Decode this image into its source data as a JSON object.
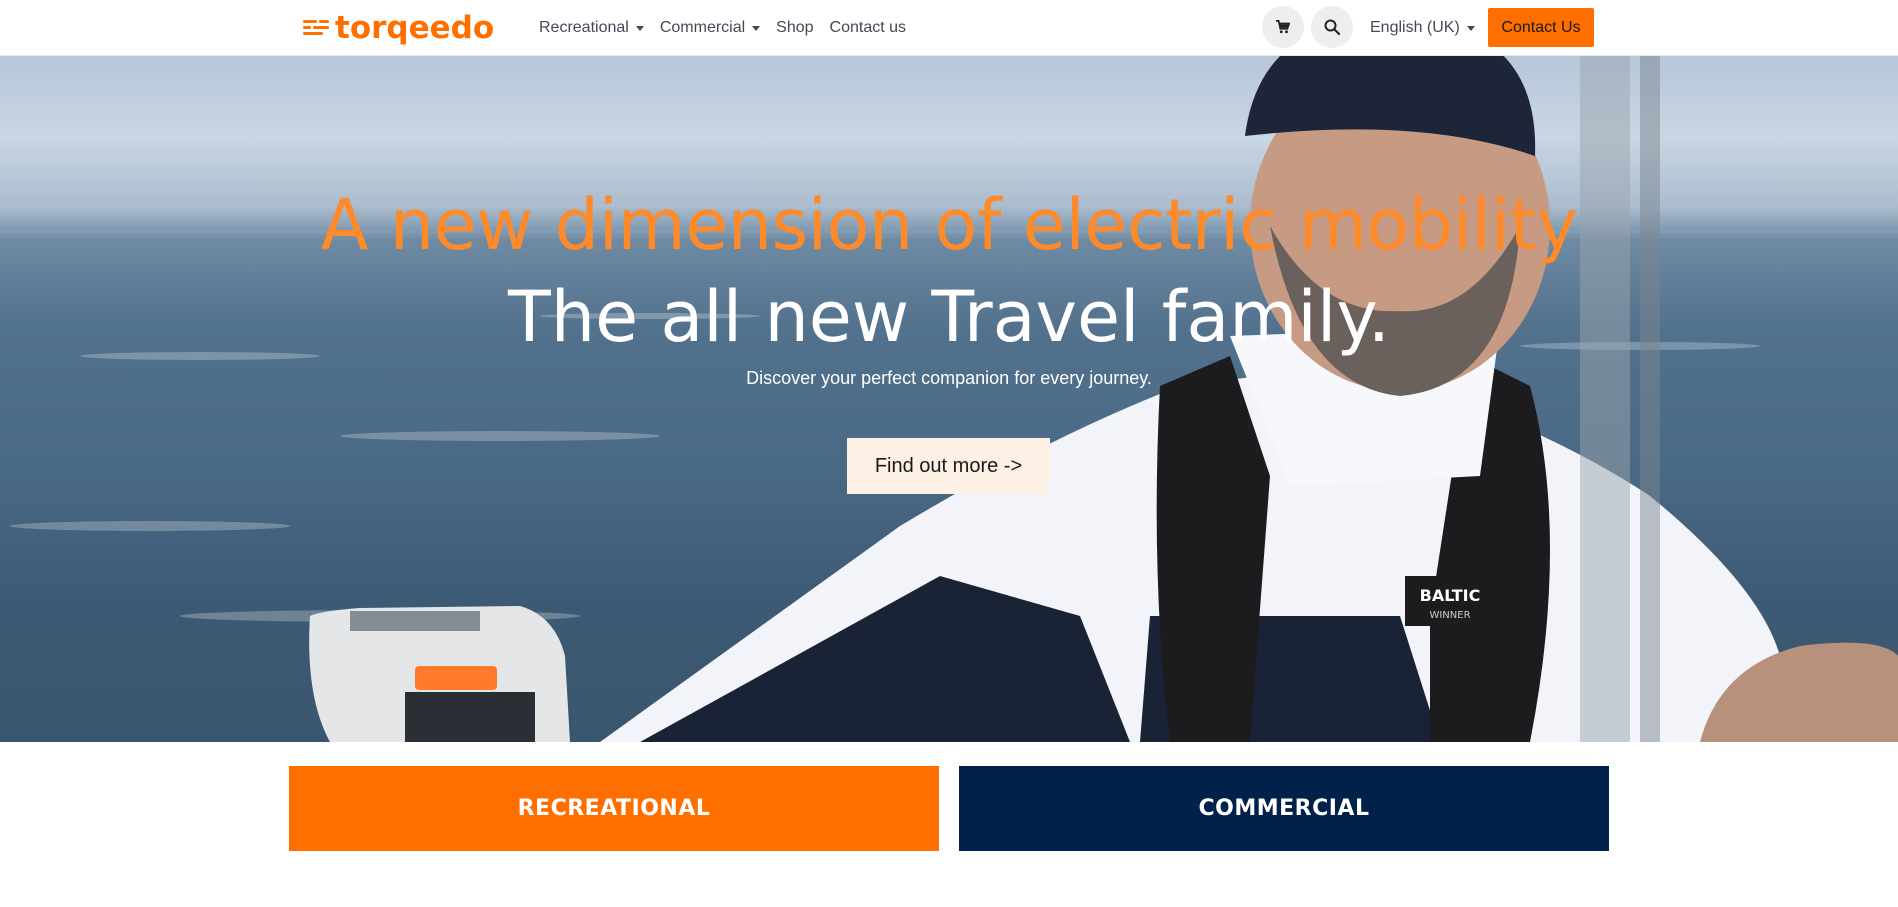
{
  "brand": {
    "logo_text": "torqeedo",
    "accent_color": "#ff6f00",
    "navy_color": "#01204a"
  },
  "nav": {
    "items": [
      {
        "label": "Recreational",
        "dropdown": true
      },
      {
        "label": "Commercial",
        "dropdown": true
      },
      {
        "label": "Shop",
        "dropdown": false
      },
      {
        "label": "Contact us",
        "dropdown": false
      }
    ],
    "cart_icon": "cart-icon",
    "search_icon": "search-icon",
    "language": "English (UK)",
    "contact_button": "Contact Us"
  },
  "hero": {
    "headline": "A new dimension of electric mobility",
    "subheadline": "The all new Travel family.",
    "tagline": "Discover your perfect companion for every journey.",
    "cta": "Find out more ->",
    "badge_text": "BALTIC",
    "badge_sub": "WINNER"
  },
  "categories": {
    "recreational": "RECREATIONAL",
    "commercial": "COMMERCIAL"
  }
}
